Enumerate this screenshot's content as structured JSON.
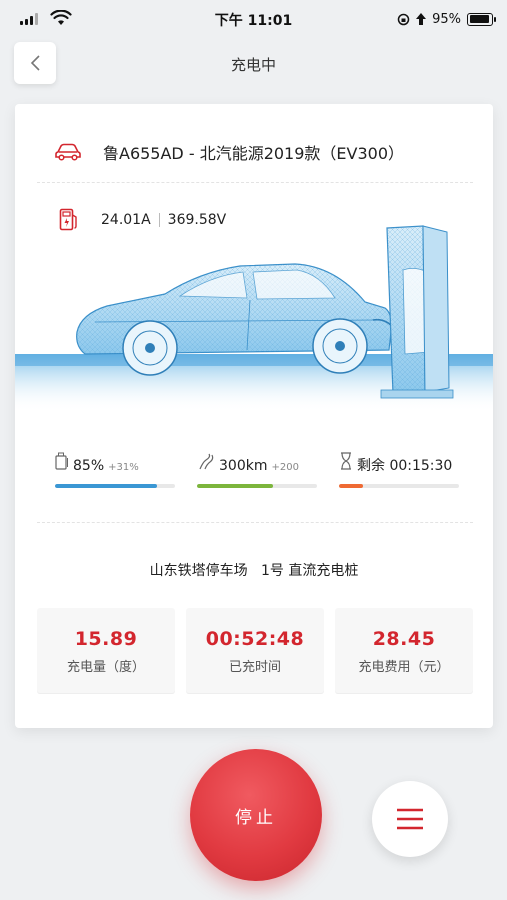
{
  "status_bar": {
    "time": "下午 11:01",
    "battery_text": "95%"
  },
  "nav": {
    "title": "充电中"
  },
  "vehicle": {
    "plate_model": "鲁A655AD - 北汽能源2019款（EV300）"
  },
  "electrical": {
    "current": "24.01A",
    "voltage": "369.58V"
  },
  "stats": {
    "battery": {
      "value": "85%",
      "delta": "+31%",
      "progress": 0.85,
      "color": "#3a97d4"
    },
    "range": {
      "value": "300km",
      "delta": "+200",
      "progress": 0.63,
      "color": "#7cb53c"
    },
    "remaining": {
      "value": "剩余 00:15:30",
      "progress": 0.2,
      "color": "#ef6a33"
    }
  },
  "station": {
    "name": "山东铁塔停车场",
    "pile": "1号 直流充电桩"
  },
  "metrics": [
    {
      "value": "15.89",
      "label": "充电量（度）"
    },
    {
      "value": "00:52:48",
      "label": "已充时间"
    },
    {
      "value": "28.45",
      "label": "充电费用（元）"
    }
  ],
  "actions": {
    "stop_label": "停止"
  },
  "colors": {
    "accent": "#d3262e",
    "blue": "#3a97d4"
  }
}
